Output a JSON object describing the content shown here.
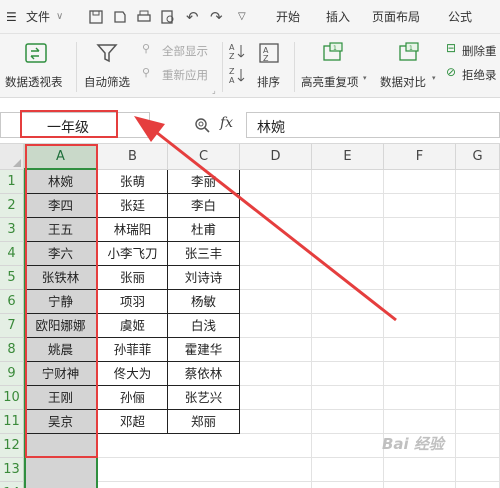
{
  "menubar": {
    "file": "文件",
    "tabs": [
      "开始",
      "插入",
      "页面布局",
      "公式"
    ]
  },
  "ribbon": {
    "pivot_table": "数据透视表",
    "auto_filter": "自动筛选",
    "show_all": "全部显示",
    "reapply": "重新应用",
    "sort": "排序",
    "highlight_dup": "高亮重复项",
    "data_compare": "数据对比",
    "delete_dup": "删除重",
    "reject_dup": "拒绝录"
  },
  "formula_bar": {
    "name_box": "一年级",
    "fx": "fx",
    "value": "林婉"
  },
  "grid": {
    "columns": [
      "A",
      "B",
      "C",
      "D",
      "E",
      "F",
      "G"
    ],
    "rows": [
      "1",
      "2",
      "3",
      "4",
      "5",
      "6",
      "7",
      "8",
      "9",
      "10",
      "11",
      "12",
      "13",
      "14"
    ],
    "data": [
      [
        "林婉",
        "张萌",
        "李丽"
      ],
      [
        "李四",
        "张廷",
        "李白"
      ],
      [
        "王五",
        "林瑞阳",
        "杜甫"
      ],
      [
        "李六",
        "小李飞刀",
        "张三丰"
      ],
      [
        "张铁林",
        "张丽",
        "刘诗诗"
      ],
      [
        "宁静",
        "项羽",
        "杨敏"
      ],
      [
        "欧阳娜娜",
        "虞姬",
        "白浅"
      ],
      [
        "姚晨",
        "孙菲菲",
        "霍建华"
      ],
      [
        "宁财神",
        "佟大为",
        "蔡依林"
      ],
      [
        "王刚",
        "孙俪",
        "张艺兴"
      ],
      [
        "吴京",
        "邓超",
        "郑丽"
      ]
    ]
  },
  "annotation_color": "#e53e3e",
  "watermark": "Bai 经验"
}
